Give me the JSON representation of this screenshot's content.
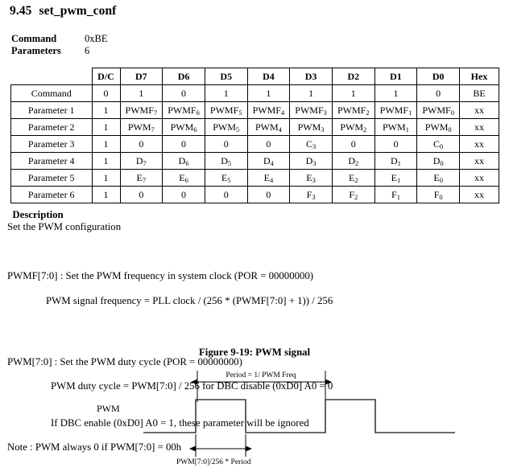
{
  "heading": {
    "number": "9.45",
    "title": "set_pwm_conf"
  },
  "summary": {
    "command_label": "Command",
    "command_value": "0xBE",
    "parameters_label": "Parameters",
    "parameters_value": "6"
  },
  "table": {
    "columns": [
      "",
      "D/C",
      "D7",
      "D6",
      "D5",
      "D4",
      "D3",
      "D2",
      "D1",
      "D0",
      "Hex"
    ],
    "rows": [
      {
        "label": "Command",
        "cells": [
          {
            "text": "0"
          },
          {
            "text": "1"
          },
          {
            "text": "0"
          },
          {
            "text": "1"
          },
          {
            "text": "1"
          },
          {
            "text": "1"
          },
          {
            "text": "1"
          },
          {
            "text": "1"
          },
          {
            "text": "0"
          }
        ],
        "hex": "BE"
      },
      {
        "label": "Parameter 1",
        "cells": [
          {
            "text": "1"
          },
          {
            "base": "PWMF",
            "sub": "7"
          },
          {
            "base": "PWMF",
            "sub": "6"
          },
          {
            "base": "PWMF",
            "sub": "5"
          },
          {
            "base": "PWMF",
            "sub": "4"
          },
          {
            "base": "PWMF",
            "sub": "3"
          },
          {
            "base": "PWMF",
            "sub": "2"
          },
          {
            "base": "PWMF",
            "sub": "1"
          },
          {
            "base": "PWMF",
            "sub": "0"
          }
        ],
        "hex": "xx"
      },
      {
        "label": "Parameter 2",
        "cells": [
          {
            "text": "1"
          },
          {
            "base": "PWM",
            "sub": "7"
          },
          {
            "base": "PWM",
            "sub": "6"
          },
          {
            "base": "PWM",
            "sub": "5"
          },
          {
            "base": "PWM",
            "sub": "4"
          },
          {
            "base": "PWM",
            "sub": "3"
          },
          {
            "base": "PWM",
            "sub": "2"
          },
          {
            "base": "PWM",
            "sub": "1"
          },
          {
            "base": "PWM",
            "sub": "0"
          }
        ],
        "hex": "xx"
      },
      {
        "label": "Parameter 3",
        "cells": [
          {
            "text": "1"
          },
          {
            "text": "0"
          },
          {
            "text": "0"
          },
          {
            "text": "0"
          },
          {
            "text": "0"
          },
          {
            "base": "C",
            "sub": "3"
          },
          {
            "text": "0"
          },
          {
            "text": "0"
          },
          {
            "base": "C",
            "sub": "0"
          }
        ],
        "hex": "xx"
      },
      {
        "label": "Parameter 4",
        "cells": [
          {
            "text": "1"
          },
          {
            "base": "D",
            "sub": "7"
          },
          {
            "base": "D",
            "sub": "6"
          },
          {
            "base": "D",
            "sub": "5"
          },
          {
            "base": "D",
            "sub": "4"
          },
          {
            "base": "D",
            "sub": "3"
          },
          {
            "base": "D",
            "sub": "2"
          },
          {
            "base": "D",
            "sub": "1"
          },
          {
            "base": "D",
            "sub": "0"
          }
        ],
        "hex": "xx"
      },
      {
        "label": "Parameter 5",
        "cells": [
          {
            "text": "1"
          },
          {
            "base": "E",
            "sub": "7"
          },
          {
            "base": "E",
            "sub": "6"
          },
          {
            "base": "E",
            "sub": "5"
          },
          {
            "base": "E",
            "sub": "4"
          },
          {
            "base": "E",
            "sub": "3"
          },
          {
            "base": "E",
            "sub": "2"
          },
          {
            "base": "E",
            "sub": "1"
          },
          {
            "base": "E",
            "sub": "0"
          }
        ],
        "hex": "xx"
      },
      {
        "label": "Parameter 6",
        "cells": [
          {
            "text": "1"
          },
          {
            "text": "0"
          },
          {
            "text": "0"
          },
          {
            "text": "0"
          },
          {
            "text": "0"
          },
          {
            "base": "F",
            "sub": "3"
          },
          {
            "base": "F",
            "sub": "2"
          },
          {
            "base": "F",
            "sub": "1"
          },
          {
            "base": "F",
            "sub": "0"
          }
        ],
        "hex": "xx"
      }
    ]
  },
  "description": {
    "title": "Description",
    "subtitle": "Set the PWM configuration",
    "pwmf_line": "PWMF[7:0] : Set the PWM frequency in system clock (POR = 00000000)",
    "pwmf_formula": "PWM signal frequency = PLL clock / (256 * (PWMF[7:0] + 1)) / 256",
    "pwm_line": "PWM[7:0] : Set the PWM duty cycle (POR = 00000000)",
    "pwm_formula": "PWM duty cycle = PWM[7:0] / 256 for DBC disable (0xD0] A0 = 0",
    "pwm_dbc": "If DBC enable (0xD0] A0 = 1, these parameter will be ignored",
    "pwm_note": "Note : PWM always 0 if PWM[7:0] = 00h"
  },
  "figure": {
    "caption": "Figure 9-19: PWM signal",
    "signal_label": "PWM",
    "period_label": "Period = 1/ PWM Freq",
    "duty_label": "PWM[7:0]/256 * Period"
  }
}
